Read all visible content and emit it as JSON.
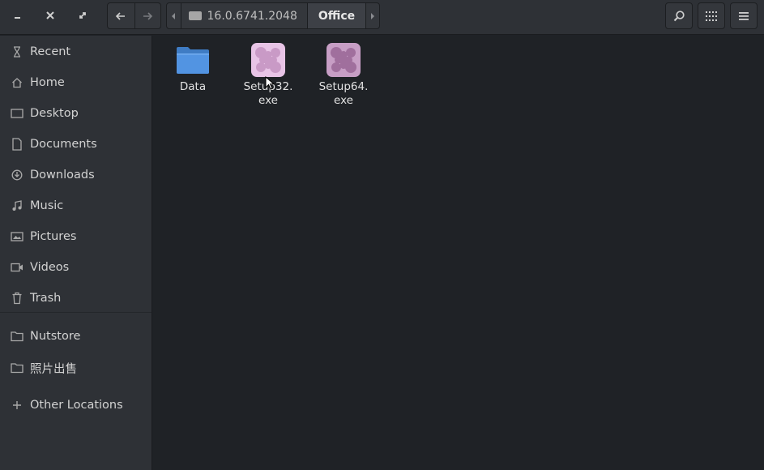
{
  "window": {
    "controls": [
      "minimize",
      "close",
      "maximize"
    ]
  },
  "navigation": {
    "back_icon": "arrow-left-icon",
    "forward_icon": "arrow-right-icon"
  },
  "path_bar": {
    "crumbs": [
      {
        "label": "16.0.6741.2048",
        "icon": "drive-icon"
      },
      {
        "label": "Office",
        "active": true
      }
    ]
  },
  "toolbar": {
    "search_icon": "search-icon",
    "view_icon": "grid-view-icon",
    "menu_icon": "hamburger-menu-icon"
  },
  "sidebar": {
    "items": [
      {
        "label": "Recent",
        "icon": "clock-icon"
      },
      {
        "label": "Home",
        "icon": "home-icon"
      },
      {
        "label": "Desktop",
        "icon": "desktop-icon"
      },
      {
        "label": "Documents",
        "icon": "document-icon"
      },
      {
        "label": "Downloads",
        "icon": "download-icon"
      },
      {
        "label": "Music",
        "icon": "music-icon"
      },
      {
        "label": "Pictures",
        "icon": "pictures-icon"
      },
      {
        "label": "Videos",
        "icon": "video-icon"
      },
      {
        "label": "Trash",
        "icon": "trash-icon"
      }
    ],
    "bookmarks": [
      {
        "label": "Nutstore",
        "icon": "folder-icon"
      },
      {
        "label": "照片出售",
        "icon": "folder-icon"
      }
    ],
    "other": {
      "label": "Other Locations",
      "icon": "plus-icon"
    }
  },
  "files": [
    {
      "name": "Data",
      "type": "folder"
    },
    {
      "name": "Setup32.\nexe",
      "type": "executable"
    },
    {
      "name": "Setup64.\nexe",
      "type": "executable"
    }
  ],
  "colors": {
    "folder": "#5294e2",
    "exe_light": "#e8c4e6",
    "exe_dark": "#b684b3"
  }
}
